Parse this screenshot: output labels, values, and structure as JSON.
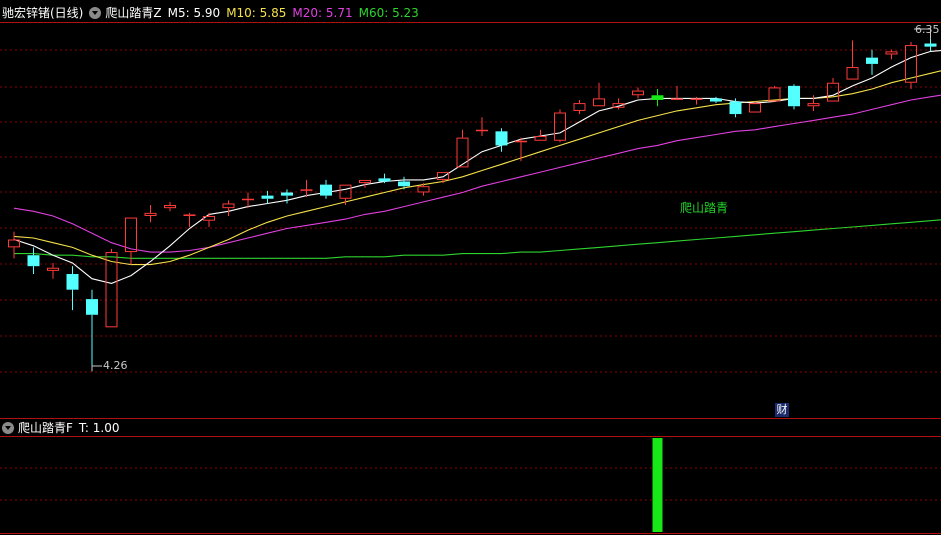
{
  "main_header": {
    "stock_name": "驰宏锌锗(日线)",
    "indicator_name": "爬山踏青Z",
    "ma": [
      {
        "label": "M5: 5.90",
        "color": "#ffffff"
      },
      {
        "label": "M10: 5.85",
        "color": "#f5e14a"
      },
      {
        "label": "M20: 5.71",
        "color": "#e040e0"
      },
      {
        "label": "M60: 5.23",
        "color": "#2ed42e"
      }
    ]
  },
  "sub_header": {
    "indicator_name": "爬山踏青F",
    "value_label": "T: 1.00"
  },
  "annotations": {
    "high": "6.35",
    "low": "4.26",
    "signal_text": "爬山踏青",
    "finance_badge": "财"
  },
  "colors": {
    "up": "#ff3a3a",
    "down": "#54ffff",
    "signal": "#18e818",
    "ma5": "#ffffff",
    "ma10": "#f5e14a",
    "ma20": "#e040e0",
    "ma60": "#2ed42e",
    "grid": "#8a0000",
    "border": "#b01010",
    "text_muted": "#c8c8c8"
  },
  "chart_data": [
    {
      "type": "candlestick",
      "title": "驰宏锌锗(日线)",
      "ylim": [
        4.0,
        6.5
      ],
      "ohlc": [
        [
          5.05,
          5.15,
          4.98,
          5.1
        ],
        [
          5.0,
          5.05,
          4.88,
          4.93
        ],
        [
          4.9,
          4.95,
          4.85,
          4.92
        ],
        [
          4.88,
          4.93,
          4.65,
          4.78
        ],
        [
          4.72,
          4.78,
          4.26,
          4.62
        ],
        [
          4.54,
          5.04,
          4.54,
          5.02
        ],
        [
          5.02,
          5.24,
          4.94,
          5.24
        ],
        [
          5.25,
          5.32,
          5.21,
          5.27
        ],
        [
          5.3,
          5.34,
          5.28,
          5.32
        ],
        [
          5.25,
          5.27,
          5.18,
          5.26
        ],
        [
          5.22,
          5.27,
          5.18,
          5.25
        ],
        [
          5.3,
          5.35,
          5.25,
          5.33
        ],
        [
          5.36,
          5.4,
          5.3,
          5.36
        ],
        [
          5.38,
          5.41,
          5.33,
          5.36
        ],
        [
          5.4,
          5.42,
          5.33,
          5.38
        ],
        [
          5.42,
          5.48,
          5.37,
          5.42
        ],
        [
          5.45,
          5.48,
          5.36,
          5.38
        ],
        [
          5.36,
          5.45,
          5.32,
          5.45
        ],
        [
          5.46,
          5.48,
          5.43,
          5.48
        ],
        [
          5.49,
          5.52,
          5.46,
          5.47
        ],
        [
          5.47,
          5.5,
          5.42,
          5.44
        ],
        [
          5.4,
          5.46,
          5.38,
          5.44
        ],
        [
          5.48,
          5.53,
          5.46,
          5.53
        ],
        [
          5.56,
          5.8,
          5.56,
          5.75
        ],
        [
          5.8,
          5.88,
          5.76,
          5.8
        ],
        [
          5.79,
          5.81,
          5.66,
          5.7
        ],
        [
          5.72,
          5.75,
          5.6,
          5.73
        ],
        [
          5.73,
          5.8,
          5.73,
          5.76
        ],
        [
          5.73,
          5.93,
          5.72,
          5.91
        ],
        [
          5.92,
          5.99,
          5.9,
          5.97
        ],
        [
          5.95,
          6.1,
          5.95,
          6.0
        ],
        [
          5.94,
          6.0,
          5.93,
          5.97
        ],
        [
          6.02,
          6.07,
          6.0,
          6.05
        ],
        [
          6.02,
          6.06,
          5.95,
          5.99
        ],
        [
          6.0,
          6.08,
          5.99,
          6.0
        ],
        [
          6.0,
          6.01,
          5.96,
          6.0
        ],
        [
          6.0,
          6.01,
          5.97,
          5.98
        ],
        [
          5.98,
          6.0,
          5.88,
          5.9
        ],
        [
          5.91,
          5.98,
          5.91,
          5.97
        ],
        [
          5.98,
          6.08,
          5.98,
          6.07
        ],
        [
          6.08,
          6.09,
          5.93,
          5.95
        ],
        [
          5.95,
          6.02,
          5.92,
          5.97
        ],
        [
          5.98,
          6.13,
          5.98,
          6.1
        ],
        [
          6.12,
          6.37,
          6.12,
          6.2
        ],
        [
          6.26,
          6.31,
          6.15,
          6.22
        ],
        [
          6.28,
          6.31,
          6.25,
          6.3
        ],
        [
          6.1,
          6.36,
          6.06,
          6.34
        ],
        [
          6.35,
          6.38,
          6.3,
          6.33
        ],
        [
          6.32,
          6.35,
          6.25,
          6.3
        ]
      ],
      "ma5": [
        5.1,
        5.06,
        5.0,
        4.95,
        4.85,
        4.82,
        4.87,
        4.96,
        5.06,
        5.17,
        5.26,
        5.28,
        5.31,
        5.33,
        5.35,
        5.38,
        5.4,
        5.42,
        5.45,
        5.47,
        5.48,
        5.48,
        5.5,
        5.58,
        5.66,
        5.7,
        5.74,
        5.76,
        5.78,
        5.85,
        5.92,
        5.95,
        5.99,
        6.0,
        6.0,
        6.0,
        6.0,
        5.98,
        5.97,
        5.98,
        6.0,
        6.0,
        6.02,
        6.08,
        6.13,
        6.2,
        6.26,
        6.3,
        6.31
      ],
      "ma10": [
        5.12,
        5.11,
        5.08,
        5.05,
        5.0,
        4.96,
        4.94,
        4.94,
        4.96,
        5.0,
        5.05,
        5.1,
        5.16,
        5.21,
        5.25,
        5.28,
        5.31,
        5.34,
        5.37,
        5.4,
        5.43,
        5.45,
        5.47,
        5.5,
        5.54,
        5.58,
        5.62,
        5.66,
        5.7,
        5.74,
        5.78,
        5.82,
        5.86,
        5.89,
        5.92,
        5.94,
        5.96,
        5.97,
        5.98,
        5.99,
        6.0,
        6.0,
        6.01,
        6.03,
        6.06,
        6.1,
        6.13,
        6.16,
        6.19
      ],
      "ma20": [
        5.3,
        5.28,
        5.25,
        5.2,
        5.14,
        5.08,
        5.04,
        5.02,
        5.02,
        5.03,
        5.05,
        5.08,
        5.11,
        5.14,
        5.17,
        5.19,
        5.21,
        5.23,
        5.26,
        5.28,
        5.31,
        5.34,
        5.37,
        5.4,
        5.44,
        5.47,
        5.5,
        5.53,
        5.56,
        5.59,
        5.62,
        5.65,
        5.68,
        5.7,
        5.73,
        5.75,
        5.77,
        5.79,
        5.8,
        5.82,
        5.84,
        5.86,
        5.88,
        5.9,
        5.93,
        5.96,
        5.99,
        6.01,
        6.03
      ],
      "ma60": [
        5.01,
        5.01,
        5.0,
        5.0,
        4.99,
        4.99,
        4.98,
        4.98,
        4.98,
        4.98,
        4.98,
        4.98,
        4.98,
        4.98,
        4.98,
        4.98,
        4.98,
        4.99,
        4.99,
        4.99,
        5.0,
        5.0,
        5.0,
        5.01,
        5.01,
        5.01,
        5.02,
        5.02,
        5.03,
        5.04,
        5.05,
        5.06,
        5.07,
        5.08,
        5.09,
        5.1,
        5.11,
        5.12,
        5.13,
        5.14,
        5.15,
        5.16,
        5.17,
        5.18,
        5.19,
        5.2,
        5.21,
        5.22,
        5.23
      ],
      "signal_candles": [
        33
      ]
    },
    {
      "type": "bar",
      "title": "爬山踏青F",
      "ylim": [
        0,
        1.0
      ],
      "values": [
        0,
        0,
        0,
        0,
        0,
        0,
        0,
        0,
        0,
        0,
        0,
        0,
        0,
        0,
        0,
        0,
        0,
        0,
        0,
        0,
        0,
        0,
        0,
        0,
        0,
        0,
        0,
        0,
        0,
        0,
        0,
        0,
        0,
        1,
        0,
        0,
        0,
        0,
        0,
        0,
        0,
        0,
        0,
        0,
        0,
        0,
        0,
        0,
        0
      ]
    }
  ]
}
